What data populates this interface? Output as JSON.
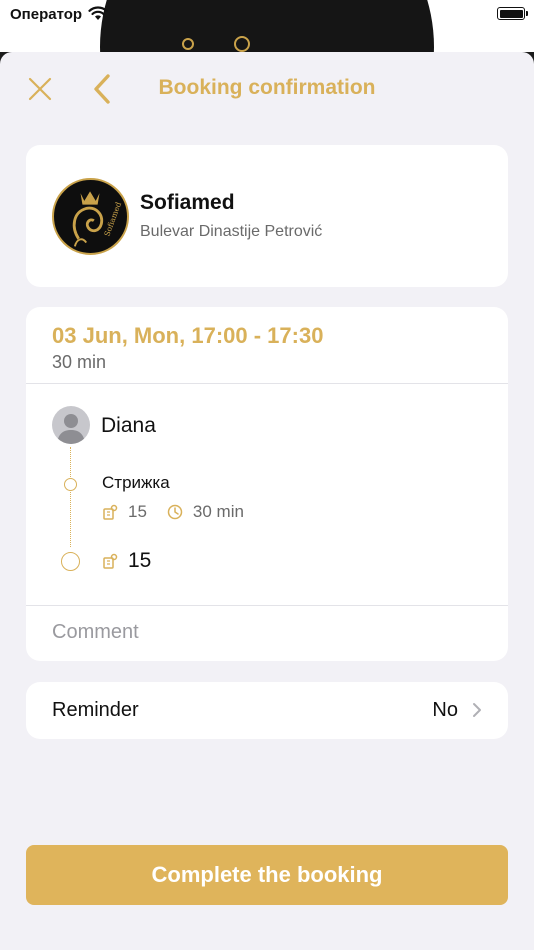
{
  "status_bar": {
    "carrier": "Оператор"
  },
  "nav": {
    "title": "Booking confirmation"
  },
  "salon": {
    "name": "Sofiamed",
    "address": "Bulevar Dinastije Petrović"
  },
  "booking": {
    "datetime": "03 Jun, Mon, 17:00 - 17:30",
    "duration": "30 min",
    "master": "Diana",
    "service": {
      "name": "Стрижка",
      "price": "15",
      "duration": "30 min"
    },
    "total": "15",
    "comment_placeholder": "Comment"
  },
  "reminder": {
    "label": "Reminder",
    "value": "No"
  },
  "cta": {
    "label": "Complete the booking"
  },
  "colors": {
    "accent": "#dfb45b",
    "sheet_bg": "#f2f1f6"
  }
}
